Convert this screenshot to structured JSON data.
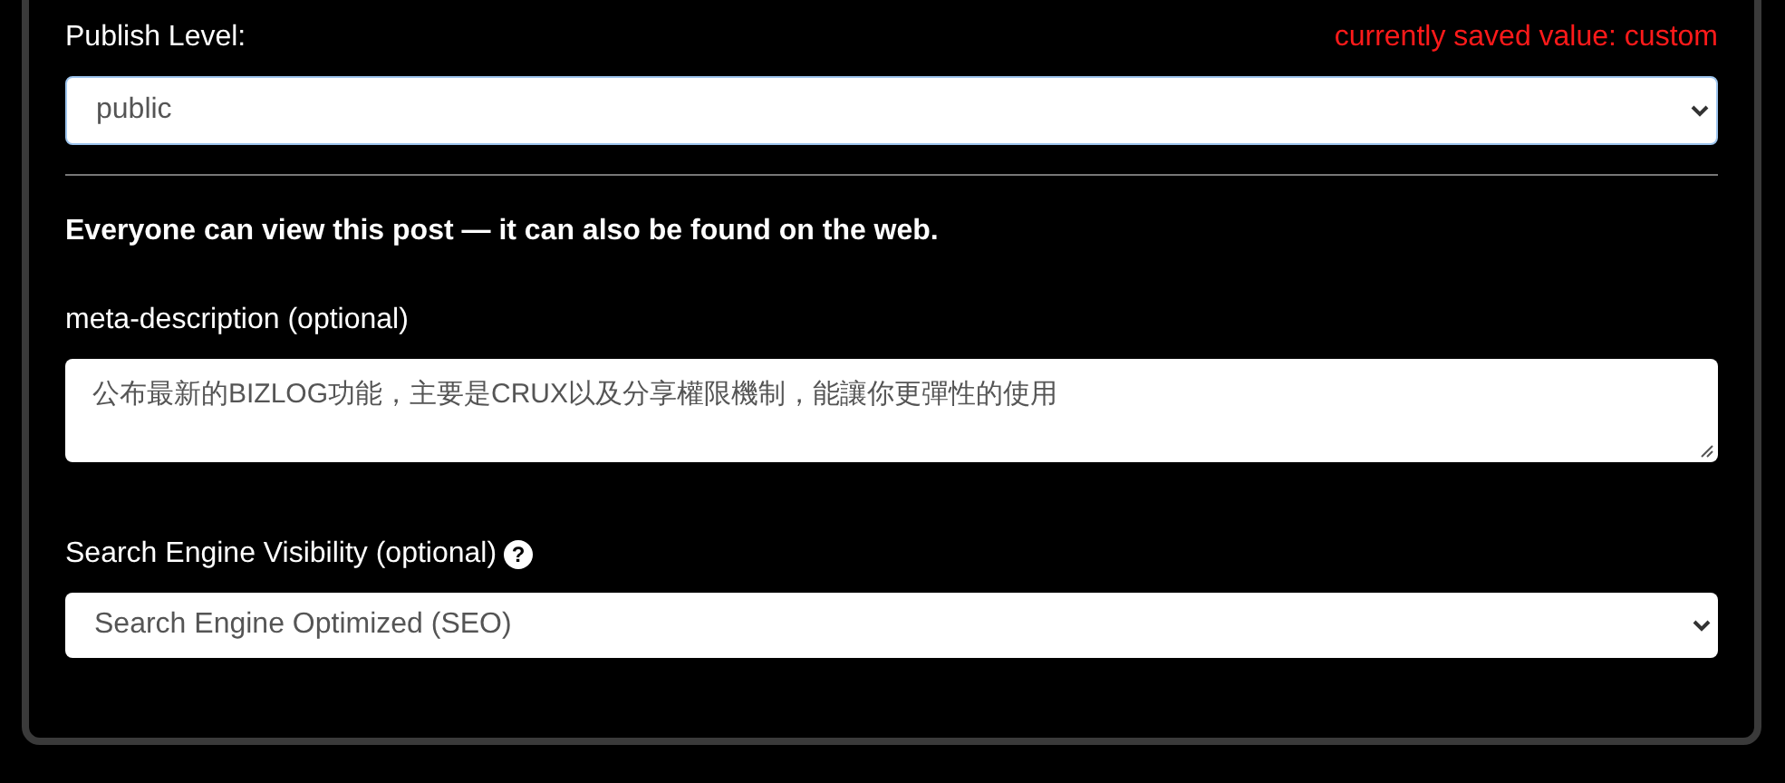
{
  "publish_level": {
    "label": "Publish Level:",
    "saved_note": "currently saved value: custom",
    "value": "public"
  },
  "publish_description": "Everyone can view this post — it can also be found on the web.",
  "meta_description": {
    "label": "meta-description (optional)",
    "value": "公布最新的BIZLOG功能，主要是CRUX以及分享權限機制，能讓你更彈性的使用"
  },
  "search_visibility": {
    "label": "Search Engine Visibility (optional)",
    "help": "?",
    "value": "Search Engine Optimized (SEO)"
  }
}
